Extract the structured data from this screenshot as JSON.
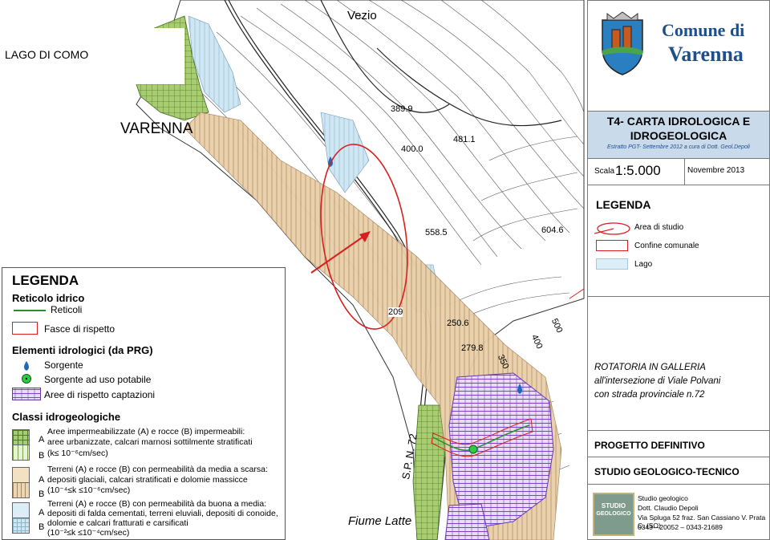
{
  "map": {
    "labels": {
      "vezio": "Vezio",
      "lago_di_como": "LAGO DI COMO",
      "varenna": "VARENNA",
      "fiume_latte": "Fiume Latte",
      "sp72": "S.P. N. 72",
      "elev": [
        "389.9",
        "400.0",
        "481.1",
        "604.6",
        "558.5",
        "209",
        "250.6",
        "279.8",
        "500",
        "400",
        "350"
      ]
    }
  },
  "header": {
    "comune_line1": "Comune di",
    "comune_line2": "Varenna",
    "title_line1": "T4- CARTA IDROLOGICA E",
    "title_line2": "IDROGEOLOGICA",
    "subtitle": "Estratto PGT- Settembre 2012 a cura di Dott. Geol.Depoli",
    "scale_label": "Scala",
    "scale_value": "1:5.000",
    "date": "Novembre 2013"
  },
  "right_legend": {
    "title": "LEGENDA",
    "items": [
      "Area di studio",
      "Confine comunale",
      "Lago"
    ]
  },
  "project": {
    "note_line1": "ROTATORIA IN GALLERIA",
    "note_line2": "all'intersezione di Viale Polvani",
    "note_line3": "con strada provinciale n.72",
    "phase": "PROGETTO DEFINITIVO",
    "studio": "STUDIO GEOLOGICO-TECNICO",
    "logo_line1": "STUDIO",
    "logo_line2": "GEOLOGICO",
    "credit1": "Studio geologico",
    "credit2": "Dott. Claudio Depoli",
    "credit3": "Via Spluga 52 fraz. San Cassiano V. Prata C. (SO)",
    "credit4": "0343—20052  –  0343-21689"
  },
  "left_legend": {
    "title": "LEGENDA",
    "reticolo_title": "Reticolo idrico",
    "reticoli": "Reticoli",
    "fasce": "Fasce di rispetto",
    "elementi_title": "Elementi idrologici (da PRG)",
    "sorgente": "Sorgente",
    "sorgente_potabile": "Sorgente ad uso potabile",
    "aree_captazioni": "Aree di rispetto captazioni",
    "classi_title": "Classi idrogeologiche",
    "class1_a": "A",
    "class1_b": "B",
    "class1_l1": "Aree impermeabilizzate (A) e rocce (B) impermeabili:",
    "class1_l2": "aree urbanizzate, calcari marnosi sottilmente stratificati",
    "class1_l3": "(k≤ 10⁻⁶cm/sec)",
    "class2_a": "A",
    "class2_b": "B",
    "class2_l1": "Terreni (A) e rocce (B) con permeabilità da media a scarsa:",
    "class2_l2": "depositi glaciali, calcari stratificati e dolomie massicce",
    "class2_l3": "(10⁻⁴≤k ≤10⁻⁶cm/sec)",
    "class3_a": "A",
    "class3_b": "B",
    "class3_l1": "Terreni (A) e rocce (B) con permeabilità da buona a media:",
    "class3_l2": "depositi di falda cementati, terreni eluviali, depositi di conoide,",
    "class3_l3": "dolomie e calcari fratturati e carsificati",
    "class3_l4": "(10⁻²≤k ≤10⁻⁴cm/sec)"
  },
  "colors": {
    "lake": "#dceef8",
    "urban": "#9fc36a",
    "scarsa": "#e6caa6",
    "buona": "#cde6f2",
    "captazioni": "#8a4fc8",
    "red": "#d62020",
    "river": "#2e8b2e"
  }
}
